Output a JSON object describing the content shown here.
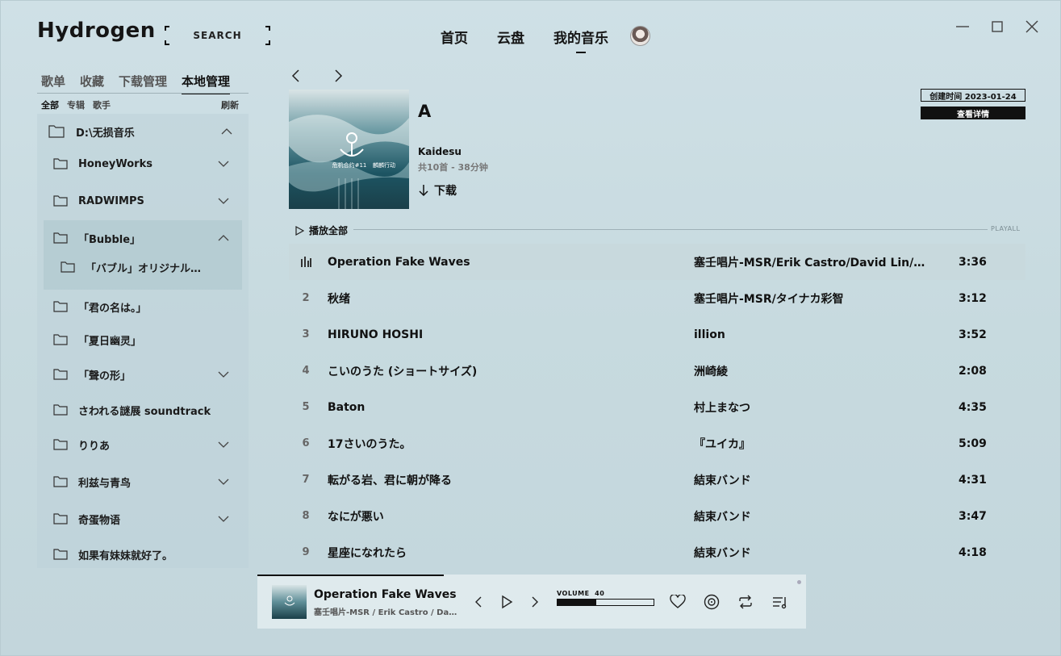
{
  "app": {
    "title": "Hydrogen"
  },
  "search": {
    "placeholder": "SEARCH"
  },
  "topnav": [
    {
      "label": "首页"
    },
    {
      "label": "云盘"
    },
    {
      "label": "我的音乐"
    }
  ],
  "sidebar": {
    "tabs": [
      {
        "label": "歌单"
      },
      {
        "label": "收藏"
      },
      {
        "label": "下载管理"
      },
      {
        "label": "本地管理"
      }
    ],
    "filters": [
      {
        "label": "全部"
      },
      {
        "label": "专辑"
      },
      {
        "label": "歌手"
      }
    ],
    "refresh": "刷新",
    "tree": [
      {
        "label": "D:\\无损音乐"
      },
      {
        "label": "HoneyWorks"
      },
      {
        "label": "RADWIMPS"
      },
      {
        "label": "「Bubble」"
      },
      {
        "label": "「バブル」オリジナル・サウンドトラック"
      },
      {
        "label": "「君の名は。」"
      },
      {
        "label": "「夏日幽灵」"
      },
      {
        "label": "「聲の形」"
      },
      {
        "label": "さわれる謎展 soundtrack"
      },
      {
        "label": "りりあ"
      },
      {
        "label": "利兹与青鸟"
      },
      {
        "label": "奇蛋物语"
      },
      {
        "label": "如果有妹妹就好了。"
      }
    ]
  },
  "album": {
    "title": "A",
    "artist": "Kaidesu",
    "meta": "共10首 - 38分钟",
    "download": "下载",
    "created": "创建时间 2023-01-24",
    "details": "查看详情",
    "cover_text_1": "危机合约#11",
    "cover_text_2": "麟麟行动"
  },
  "playall": {
    "label": "播放全部",
    "tag": "PLAYALL"
  },
  "tracks": [
    {
      "no": "1",
      "title": "Operation Fake Waves",
      "artist": "塞壬唱片-MSR/Erik Castro/David Lin/Sky Wang",
      "duration": "3:36"
    },
    {
      "no": "2",
      "title": "秋绪",
      "artist": "塞壬唱片-MSR/タイナカ彩智",
      "duration": "3:12"
    },
    {
      "no": "3",
      "title": "HIRUNO HOSHI",
      "artist": "illion",
      "duration": "3:52"
    },
    {
      "no": "4",
      "title": "こいのうた (ショートサイズ)",
      "artist": "洲崎綾",
      "duration": "2:08"
    },
    {
      "no": "5",
      "title": "Baton",
      "artist": "村上まなつ",
      "duration": "4:35"
    },
    {
      "no": "6",
      "title": "17さいのうた。",
      "artist": "『ユイカ』",
      "duration": "5:09"
    },
    {
      "no": "7",
      "title": "転がる岩、君に朝が降る",
      "artist": "結束バンド",
      "duration": "4:31"
    },
    {
      "no": "8",
      "title": "なにが悪い",
      "artist": "結束バンド",
      "duration": "3:47"
    },
    {
      "no": "9",
      "title": "星座になれたら",
      "artist": "結束バンド",
      "duration": "4:18"
    }
  ],
  "player": {
    "title": "Operation Fake Waves",
    "artist": "塞壬唱片-MSR / Erik Castro / David Lin / Sky Wang",
    "volume_label": "VOLUME",
    "volume": "40",
    "volume_fraction": 0.4,
    "progress_fraction": 0.34
  },
  "colors": {
    "accent": "#111111",
    "background": "#c7dadf"
  }
}
